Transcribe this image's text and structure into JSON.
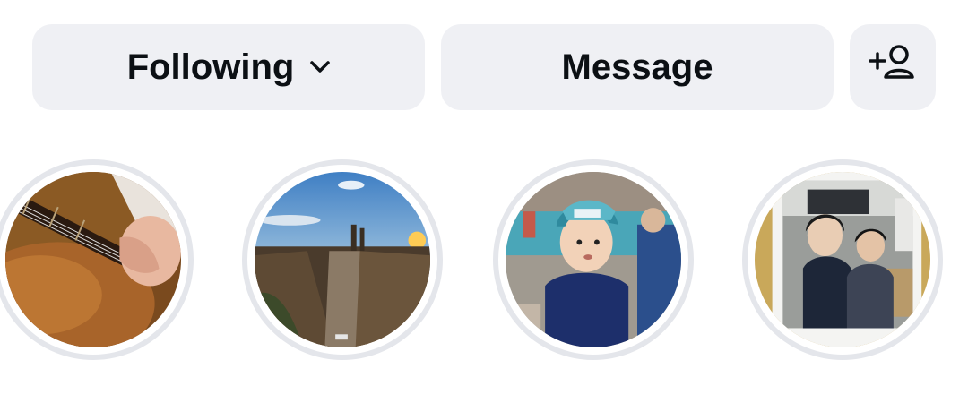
{
  "actions": {
    "following_label": "Following",
    "message_label": "Message",
    "following_icon": "chevron-down-icon",
    "add_user_icon": "add-user-icon"
  },
  "stories": [
    {
      "thumbnail": "guitar-playing-photo"
    },
    {
      "thumbnail": "city-sunset-photo"
    },
    {
      "thumbnail": "child-in-cap-photo"
    },
    {
      "thumbnail": "polaroid-friends-photo"
    }
  ],
  "colors": {
    "button_bg": "#eff0f4",
    "text": "#0c1014",
    "story_ring": "#e4e6eb"
  }
}
